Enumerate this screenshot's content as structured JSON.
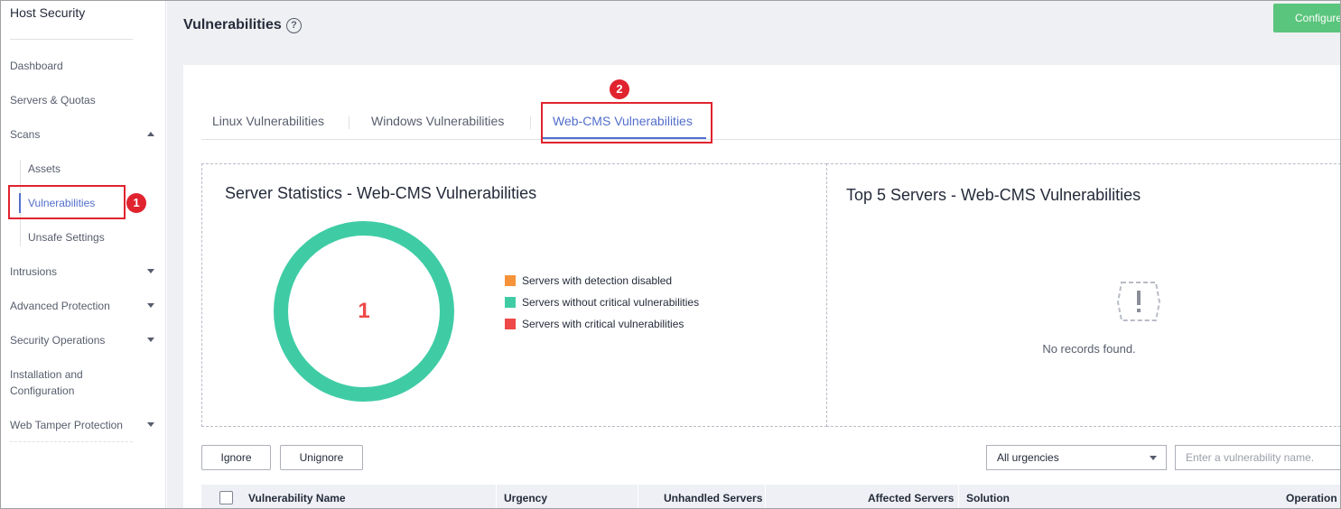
{
  "sidebar": {
    "title": "Host Security",
    "items": [
      {
        "label": "Dashboard"
      },
      {
        "label": "Servers & Quotas"
      },
      {
        "label": "Scans"
      },
      {
        "label": "Intrusions"
      },
      {
        "label": "Advanced Protection"
      },
      {
        "label": "Security Operations"
      },
      {
        "label": "Installation and Configuration"
      },
      {
        "label": "Web Tamper Protection"
      }
    ],
    "scans_sub": [
      {
        "label": "Assets"
      },
      {
        "label": "Vulnerabilities"
      },
      {
        "label": "Unsafe Settings"
      }
    ],
    "badge1": "1"
  },
  "header": {
    "title": "Vulnerabilities",
    "help": "?",
    "configure_label": "Configure"
  },
  "tabs": [
    {
      "label": "Linux Vulnerabilities"
    },
    {
      "label": "Windows Vulnerabilities"
    },
    {
      "label": "Web-CMS Vulnerabilities"
    }
  ],
  "badge2": "2",
  "stats": {
    "title": "Server Statistics - Web-CMS Vulnerabilities",
    "count": "1",
    "legend": [
      {
        "label": "Servers with detection disabled",
        "color": "#f5923a"
      },
      {
        "label": "Servers without critical vulnerabilities",
        "color": "#3fcca5"
      },
      {
        "label": "Servers with critical vulnerabilities",
        "color": "#ee4848"
      }
    ]
  },
  "top5": {
    "title": "Top 5 Servers - Web-CMS Vulnerabilities",
    "empty_text": "No records found."
  },
  "actions": {
    "ignore_label": "Ignore",
    "unignore_label": "Unignore",
    "urgency_selected": "All urgencies",
    "search_placeholder": "Enter a vulnerability name."
  },
  "table": {
    "columns": [
      "Vulnerability Name",
      "Urgency",
      "Unhandled Servers",
      "Affected Servers",
      "Solution",
      "Operation"
    ]
  }
}
